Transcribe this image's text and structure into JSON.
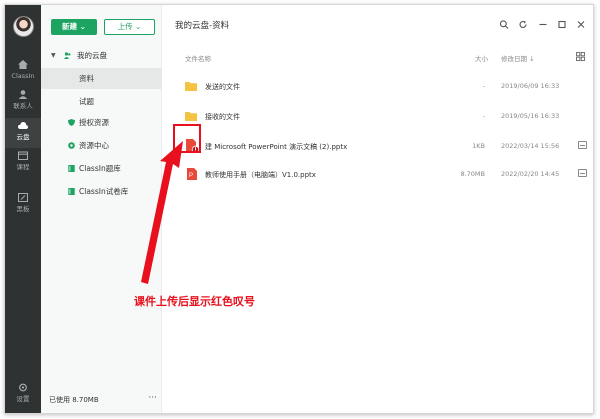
{
  "rail": {
    "items": [
      {
        "label": "ClassIn",
        "icon": "home-icon"
      },
      {
        "label": "联系人",
        "icon": "contacts-icon"
      },
      {
        "label": "云盘",
        "icon": "cloud-icon",
        "active": true
      },
      {
        "label": "课程",
        "icon": "calendar-icon"
      },
      {
        "label": "黑板",
        "icon": "blackboard-icon"
      }
    ],
    "settings_label": "设置"
  },
  "sidebar": {
    "new_label": "新建",
    "upload_label": "上传",
    "root_label": "我的云盘",
    "children": [
      "资料",
      "试题"
    ],
    "sections": [
      {
        "label": "授权资源",
        "icon": "shield-icon"
      },
      {
        "label": "资源中心",
        "icon": "globe-icon"
      },
      {
        "label": "ClassIn题库",
        "icon": "book-icon"
      },
      {
        "label": "ClassIn试卷库",
        "icon": "book-icon"
      }
    ],
    "usage": "已使用 8.70MB",
    "more": "···"
  },
  "main": {
    "breadcrumb": "我的云盘-资料",
    "columns": {
      "name": "文件名称",
      "size": "大小",
      "modified": "修改日期 ↓"
    },
    "files": [
      {
        "name": "发送的文件",
        "size": "-",
        "date": "2019/06/09 16:33",
        "type": "folder"
      },
      {
        "name": "接收的文件",
        "size": "-",
        "date": "2019/05/16 16:33",
        "type": "folder"
      },
      {
        "name": "建 Microsoft PowerPoint 演示文稿 (2).pptx",
        "size": "1KB",
        "date": "2022/03/14 15:56",
        "type": "pptx-error"
      },
      {
        "name": "教师使用手册（电脑端）V1.0.pptx",
        "size": "8.70MB",
        "date": "2022/02/20 14:45",
        "type": "pptx"
      }
    ]
  },
  "annotation": {
    "text": "课件上传后显示红色叹号",
    "color": "#e8101c"
  },
  "colors": {
    "accent": "#1da462",
    "rail": "#2f3233",
    "folder": "#f5c342",
    "pptx": "#e8493b"
  }
}
